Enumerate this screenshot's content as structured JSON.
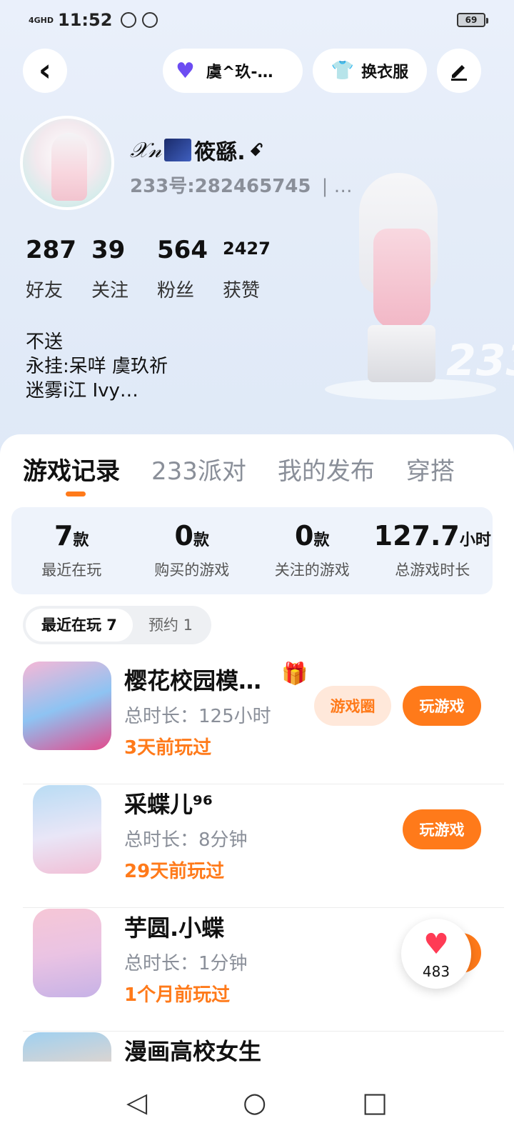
{
  "status": {
    "signal": "4GHD",
    "time": "11:52",
    "battery": "69"
  },
  "header": {
    "back": "‹",
    "profile_pill": "虞^玖-…",
    "outfit_label": "换衣服",
    "edit_icon": "pencil-icon"
  },
  "profile": {
    "nickname_prefix": "𝒳𝓃",
    "nickname": "筱繇.",
    "nickname_suffix": "ꗃ",
    "uid": "233号:282465745",
    "uid_more": "| …",
    "stats": [
      {
        "value": "287",
        "label": "好友"
      },
      {
        "value": "39",
        "label": "关注"
      },
      {
        "value": "564",
        "label": "粉丝"
      },
      {
        "value": "2427",
        "label": "获赞"
      }
    ],
    "bio": [
      "不送",
      "永挂:呆咩  虞玖祈",
      "迷雾i江  Ivy…"
    ]
  },
  "deco_text": "233",
  "tabs": [
    "游戏记录",
    "233派对",
    "我的发布",
    "穿搭"
  ],
  "summary": [
    {
      "value": "7",
      "unit": "款",
      "label": "最近在玩"
    },
    {
      "value": "0",
      "unit": "款",
      "label": "购买的游戏"
    },
    {
      "value": "0",
      "unit": "款",
      "label": "关注的游戏"
    },
    {
      "value": "127.7",
      "unit": "小时",
      "label": "总游戏时长"
    }
  ],
  "filters": [
    "最近在玩 7",
    "预约 1"
  ],
  "games": [
    {
      "title": "樱花校园模…",
      "duration": "总时长：125小时",
      "last": "3天前玩过",
      "circle": "游戏圈",
      "play": "玩游戏"
    },
    {
      "title": "采蝶儿⁹⁶",
      "duration": "总时长：8分钟",
      "last": "29天前玩过",
      "play": "玩游戏"
    },
    {
      "title": "芋圆.小蝶",
      "duration": "总时长：1分钟",
      "last": "1个月前玩过",
      "play": "玩游戏"
    },
    {
      "title": "漫画高校女生"
    }
  ],
  "likes": "483",
  "nav": {
    "back": "◁",
    "home": "○",
    "recent": "□"
  },
  "colors": {
    "accent": "#ff7a1a",
    "accent_light": "#ffe8da",
    "heart": "#ff3b55",
    "pill_heart": "#6c4cf2"
  }
}
